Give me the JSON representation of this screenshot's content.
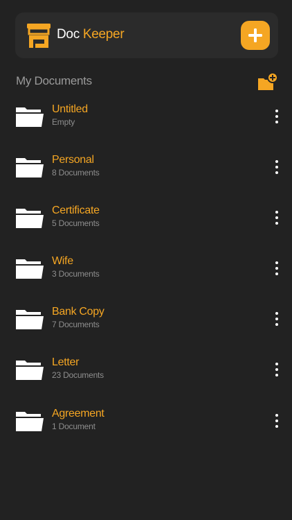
{
  "header": {
    "title_part1": "Doc",
    "title_part2": "Keeper",
    "logo_icon": "doc-keeper-logo-icon",
    "add_icon": "plus-icon",
    "accent_color": "#f5a623"
  },
  "section": {
    "title": "My Documents",
    "new_folder_icon": "folder-add-icon"
  },
  "folders": [
    {
      "name": "Untitled",
      "subtitle": "Empty"
    },
    {
      "name": "Personal",
      "subtitle": "8 Documents"
    },
    {
      "name": "Certificate",
      "subtitle": "5 Documents"
    },
    {
      "name": "Wife",
      "subtitle": "3 Documents"
    },
    {
      "name": "Bank Copy",
      "subtitle": "7 Documents"
    },
    {
      "name": "Letter",
      "subtitle": "23 Documents"
    },
    {
      "name": "Agreement",
      "subtitle": "1 Document"
    }
  ]
}
